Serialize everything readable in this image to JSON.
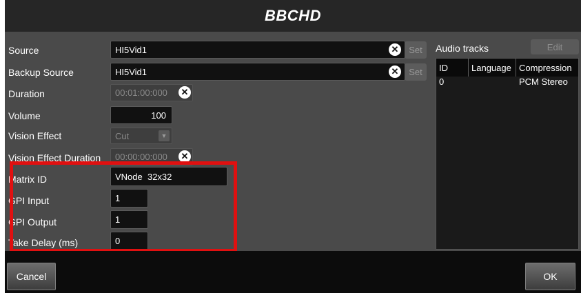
{
  "window": {
    "title": "BBCHD"
  },
  "form": {
    "source": {
      "label": "Source",
      "value": "HI5Vid1",
      "set_label": "Set"
    },
    "backup_source": {
      "label": "Backup Source",
      "value": "HI5Vid1",
      "set_label": "Set"
    },
    "duration": {
      "label": "Duration",
      "value": "00:01:00:000"
    },
    "volume": {
      "label": "Volume",
      "value": "100"
    },
    "vision_effect": {
      "label": "Vision Effect",
      "value": "Cut"
    },
    "vision_effect_duration": {
      "label": "Vision Effect Duration",
      "value": "00:00:00:000"
    },
    "matrix_id": {
      "label": "Matrix ID",
      "value": "VNode  32x32"
    },
    "gpi_input": {
      "label": "GPI Input",
      "value": "1"
    },
    "gpi_output": {
      "label": "GPI Output",
      "value": "1"
    },
    "take_delay": {
      "label": "Take Delay (ms)",
      "value": "0"
    }
  },
  "audio": {
    "title": "Audio tracks",
    "edit_label": "Edit",
    "columns": [
      "ID",
      "Language",
      "Compression"
    ],
    "rows": [
      {
        "id": "0",
        "language": "",
        "compression": "PCM Stereo"
      }
    ]
  },
  "footer": {
    "cancel_label": "Cancel",
    "ok_label": "OK"
  },
  "colors": {
    "highlight": "#e01010",
    "panel": "#4a4a4a",
    "field": "#111111"
  },
  "icons": {
    "clear": "clear-x-icon",
    "dropdown": "chevron-down-icon"
  }
}
